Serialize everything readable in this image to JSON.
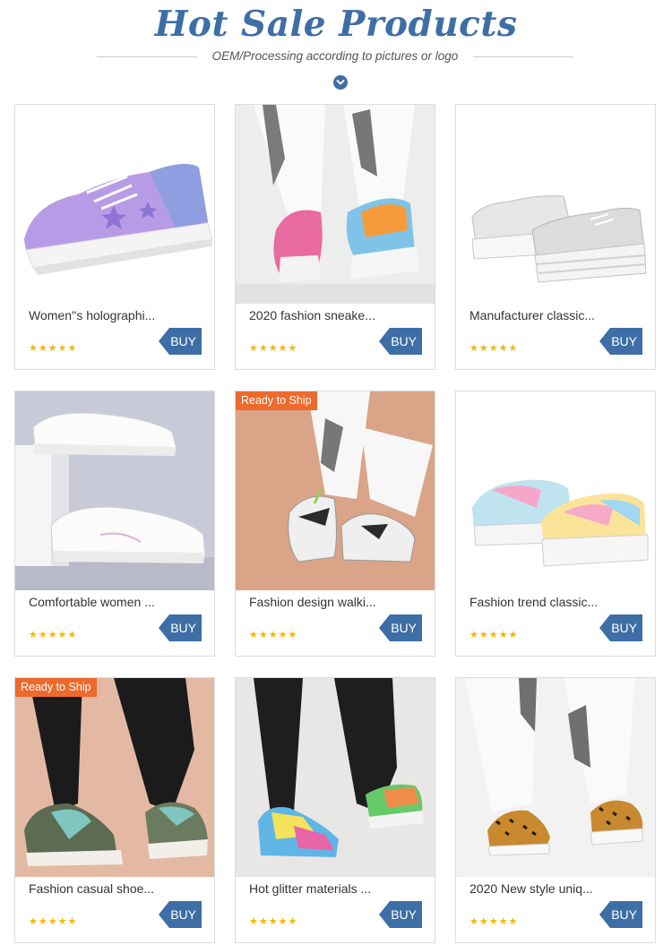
{
  "header": {
    "title": "Hot Sale Products",
    "subtitle": "OEM/Processing according to pictures or logo"
  },
  "colors": {
    "brand": "#3e6ea6",
    "badge": "#ee6a2c",
    "stars": "#f2b705"
  },
  "products": [
    {
      "name": "Women''s holographi...",
      "rating": "★★★★★",
      "buy": "BUY",
      "badge": "",
      "photo": "lilac-holographic-platform-sneaker"
    },
    {
      "name": "2020 fashion sneake...",
      "rating": "★★★★★",
      "buy": "BUY",
      "badge": "",
      "photo": "rainbow-chunky-sneakers-on-model"
    },
    {
      "name": "Manufacturer classic...",
      "rating": "★★★★★",
      "buy": "BUY",
      "badge": "",
      "photo": "silver-platform-sneakers"
    },
    {
      "name": "Comfortable women ...",
      "rating": "★★★★★",
      "buy": "BUY",
      "badge": "",
      "photo": "white-sneakers-on-blocks"
    },
    {
      "name": "Fashion design walki...",
      "rating": "★★★★★",
      "buy": "BUY",
      "badge": "Ready to Ship",
      "photo": "white-chunky-walking-sneakers"
    },
    {
      "name": "Fashion trend classic...",
      "rating": "★★★★★",
      "buy": "BUY",
      "badge": "",
      "photo": "tie-dye-platform-sneakers"
    },
    {
      "name": "Fashion casual shoe...",
      "rating": "★★★★★",
      "buy": "BUY",
      "badge": "Ready to Ship",
      "photo": "green-casual-sneakers-on-model"
    },
    {
      "name": "Hot glitter materials ...",
      "rating": "★★★★★",
      "buy": "BUY",
      "badge": "",
      "photo": "rainbow-glitter-sneakers"
    },
    {
      "name": "2020 New style uniq...",
      "rating": "★★★★★",
      "buy": "BUY",
      "badge": "",
      "photo": "leopard-print-sneakers"
    }
  ]
}
